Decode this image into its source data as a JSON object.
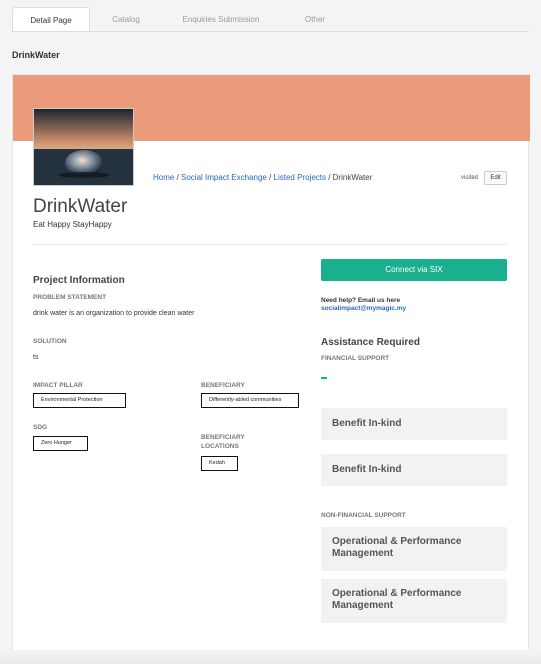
{
  "tabs": [
    "Detail Page",
    "Catalog",
    "Enquiries Submission",
    "Other"
  ],
  "page_title": "DrinkWater",
  "breadcrumb": {
    "home": "Home",
    "sep": " / ",
    "exchange": "Social Impact Exchange",
    "listed": "Listed Projects",
    "current": "DrinkWater"
  },
  "visited": "visited",
  "edit": "Edit",
  "project": {
    "name": "DrinkWater",
    "tagline": "Eat Happy StayHappy"
  },
  "info": {
    "heading": "Project Information",
    "problem_label": "PROBLEM STATEMENT",
    "problem": "drink water is an organization to provide clean water",
    "solution_label": "SOLUTION",
    "solution": "ts",
    "impact_label": "IMPACT PILLAR",
    "impact": "Environmental Protection",
    "sdg_label": "SDG",
    "sdg": "Zero Hunger",
    "beneficiary_label": "BENEFICIARY",
    "beneficiary": "Differently-abled communities",
    "locations_label": "BENEFICIARY LOCATIONS",
    "location": "Kedah"
  },
  "connect": "Connect via SIX",
  "help": {
    "text": "Need help? Email us here",
    "email": "socialimpact@mymagic.my"
  },
  "assistance": {
    "heading": "Assistance Required",
    "financial_label": "FINANCIAL SUPPORT",
    "benefit1": "Benefit In-kind",
    "benefit2": "Benefit In-kind",
    "nonfin_label": "NON-FINANCIAL SUPPORT",
    "op1": "Operational & Performance Management",
    "op2": "Operational & Performance Management"
  },
  "colors": {
    "banner": "#ec9a7c",
    "accent": "#1aaf8f",
    "link": "#2a67b8"
  },
  "icons": {
    "thumbnail": "crystal-ball-photo"
  }
}
